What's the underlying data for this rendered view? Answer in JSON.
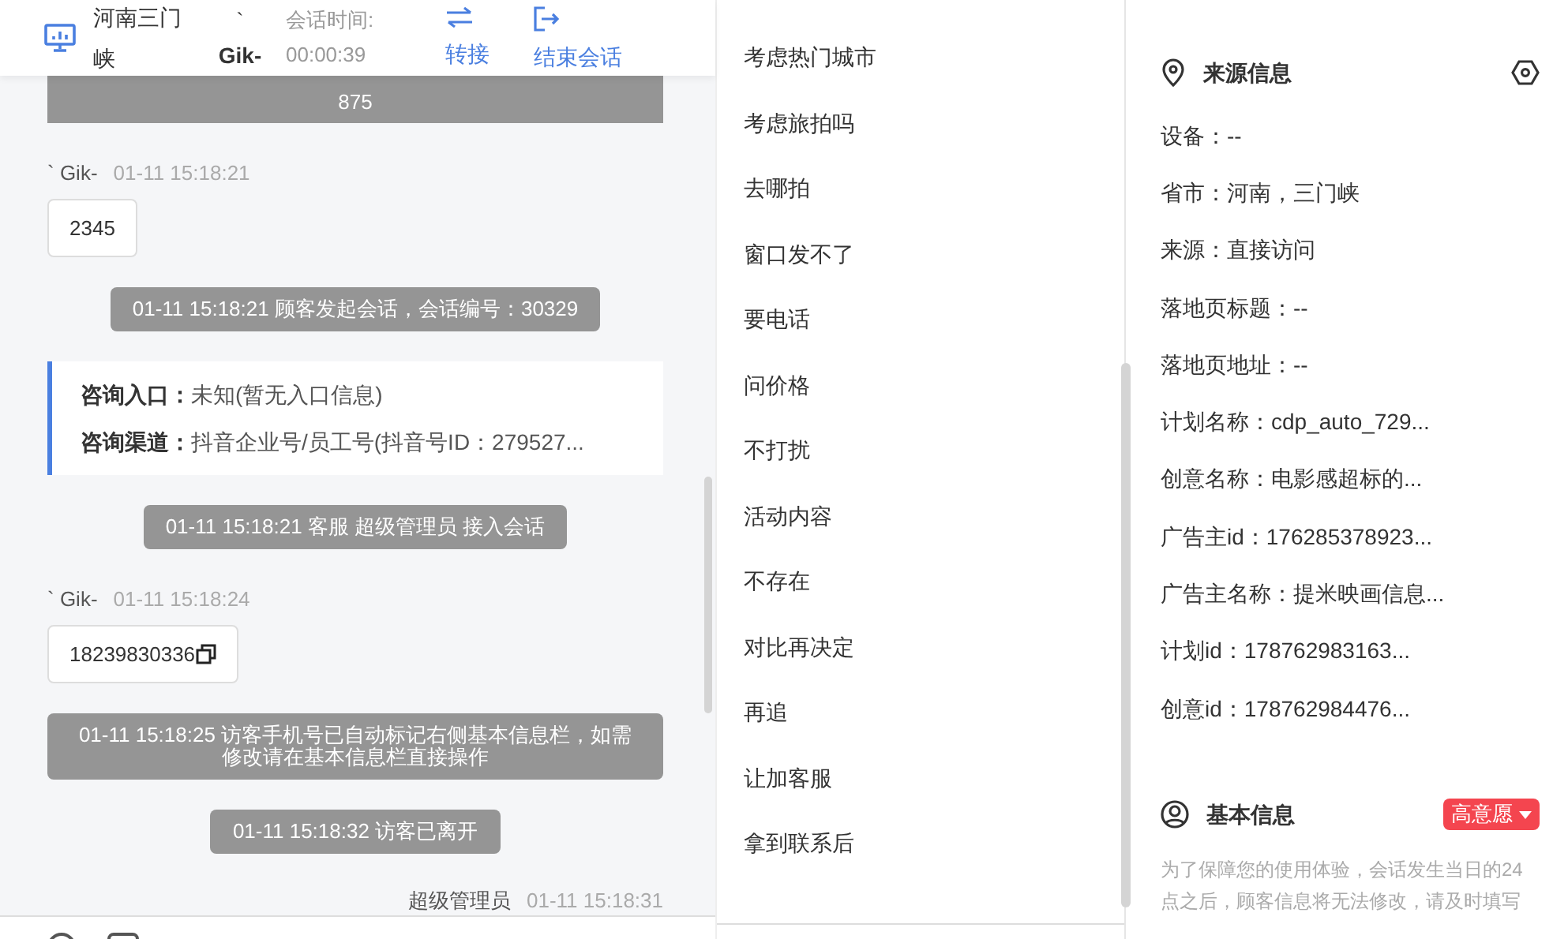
{
  "header": {
    "visitor_name": "河南三门峡",
    "visitor_mark": "`",
    "visitor_nick": "Gik-",
    "timer_label": "会话时间:",
    "timer": "00:00:39",
    "actions": [
      {
        "kind": "transfer",
        "label": "转接"
      },
      {
        "kind": "end",
        "label": "结束会话"
      }
    ]
  },
  "messages": [
    {
      "kind": "system",
      "partial": true,
      "text": "875"
    },
    {
      "kind": "visitor",
      "sender": "` Gik-",
      "time": "01-11 15:18:21",
      "text": "2345",
      "copyable": false
    },
    {
      "kind": "system",
      "partial": false,
      "text": "01-11 15:18:21 顾客发起会话，会话编号：30329"
    },
    {
      "kind": "info",
      "rows": [
        {
          "label": "咨询入口：",
          "value": "未知(暂无入口信息)"
        },
        {
          "label": "咨询渠道：",
          "value": "抖音企业号/员工号(抖音号ID：279527..."
        }
      ]
    },
    {
      "kind": "system",
      "partial": false,
      "text": "01-11 15:18:21 客服 超级管理员 接入会话"
    },
    {
      "kind": "visitor",
      "sender": "` Gik-",
      "time": "01-11 15:18:24",
      "text": "18239830336",
      "copyable": true
    },
    {
      "kind": "system",
      "partial": false,
      "text": "01-11 15:18:25 访客手机号已自动标记右侧基本信息栏，如需修改请在基本信息栏直接操作"
    },
    {
      "kind": "system",
      "partial": false,
      "text": "01-11 15:18:32 访客已离开"
    },
    {
      "kind": "agent",
      "sender": "超级管理员",
      "time": "01-11 15:18:31"
    }
  ],
  "quick_replies": [
    "考虑热门城市",
    "考虑旅拍吗",
    "去哪拍",
    "窗口发不了",
    "要电话",
    "问价格",
    "不打扰",
    "活动内容",
    "不存在",
    "对比再决定",
    "再追",
    "让加客服",
    "拿到联系后"
  ],
  "source_info": {
    "title": "来源信息",
    "fields": [
      "设备：--",
      "省市：河南，三门峡",
      "来源：直接访问",
      "落地页标题：--",
      "落地页地址：--",
      "计划名称：cdp_auto_729...",
      "创意名称：电影感超标的...",
      "广告主id：176285378923...",
      "广告主名称：提米映画信息...",
      "计划id：178762983163...",
      "创意id：178762984476..."
    ]
  },
  "basic_info": {
    "title": "基本信息",
    "intent": "高意愿",
    "notice": "为了保障您的使用体验，会话发生当日的24点之后，顾客信息将无法修改，请及时填写"
  }
}
